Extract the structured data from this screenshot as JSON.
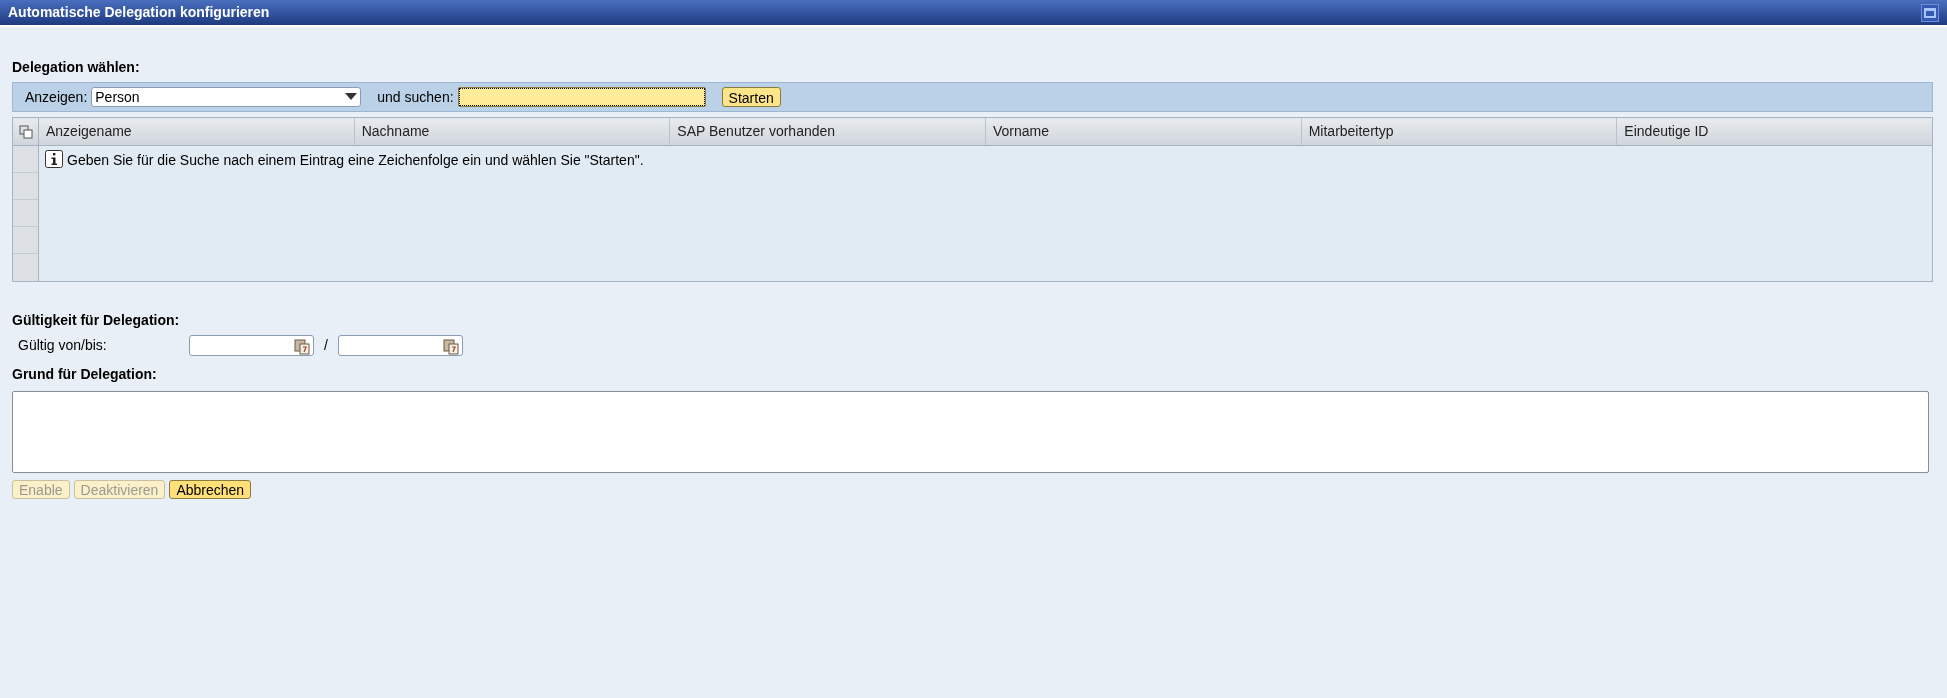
{
  "window": {
    "title": "Automatische Delegation konfigurieren"
  },
  "delegation": {
    "heading": "Delegation wählen:",
    "show_label": "Anzeigen:",
    "show_value": "Person",
    "search_label": "und suchen:",
    "search_button": "Starten"
  },
  "table": {
    "columns": [
      "Anzeigename",
      "Nachname",
      "SAP Benutzer vorhanden",
      "Vorname",
      "Mitarbeitertyp",
      "Eindeutige ID"
    ],
    "message": "Geben Sie für die Suche nach einem Eintrag eine Zeichenfolge ein und wählen Sie \"Starten\"."
  },
  "validity": {
    "heading": "Gültigkeit für Delegation:",
    "label": "Gültig von/bis:",
    "separator": "/"
  },
  "reason": {
    "heading": "Grund für Delegation:"
  },
  "buttons": [
    {
      "label": "Enable",
      "disabled": true
    },
    {
      "label": "Deaktivieren",
      "disabled": true
    },
    {
      "label": "Abbrechen",
      "disabled": false
    }
  ]
}
